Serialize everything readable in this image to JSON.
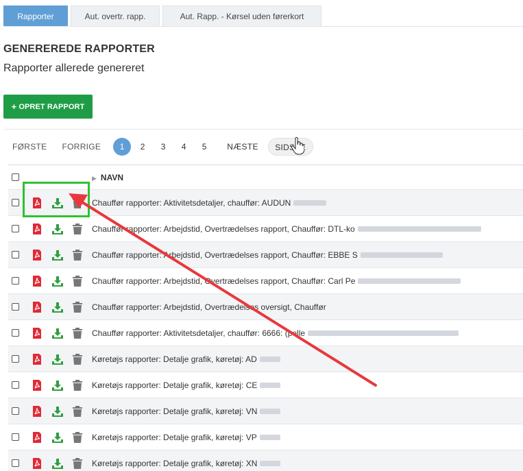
{
  "tabs": [
    {
      "label": "Rapporter",
      "active": true
    },
    {
      "label": "Aut. overtr. rapp.",
      "active": false
    },
    {
      "label": "Aut. Rapp. - Kørsel uden førerkort",
      "active": false
    }
  ],
  "section": {
    "title": "GENEREREDE RAPPORTER",
    "subtitle": "Rapporter allerede genereret"
  },
  "create_button": {
    "label": "OPRET RAPPORT",
    "icon": "plus-icon"
  },
  "pagination": {
    "first": "FØRSTE",
    "prev": "FORRIGE",
    "pages": [
      "1",
      "2",
      "3",
      "4",
      "5"
    ],
    "current": "1",
    "next": "NÆSTE",
    "last": "SIDSTE"
  },
  "table": {
    "header": {
      "name": "NAVN"
    },
    "rows": [
      {
        "name": "Chauffør rapporter: Aktivitetsdetaljer, chauffør: AUDUN"
      },
      {
        "name": "Chauffør rapporter: Arbejdstid, Overtrædelses rapport, Chauffør: DTL-ko"
      },
      {
        "name": "Chauffør rapporter: Arbejdstid, Overtrædelses rapport, Chauffør: EBBE S"
      },
      {
        "name": "Chauffør rapporter: Arbejdstid, Overtrædelses rapport, Chauffør: Carl Pe"
      },
      {
        "name": "Chauffør rapporter: Arbejdstid, Overtrædelses oversigt, Chauffør"
      },
      {
        "name": "Chauffør rapporter: Aktivitetsdetaljer, chauffør: 6666: (pelle"
      },
      {
        "name": "Køretøjs rapporter: Detalje grafik, køretøj: AD"
      },
      {
        "name": "Køretøjs rapporter: Detalje grafik, køretøj: CE"
      },
      {
        "name": "Køretøjs rapporter: Detalje grafik, køretøj: VN"
      },
      {
        "name": "Køretøjs rapporter: Detalje grafik, køretøj: VP"
      },
      {
        "name": "Køretøjs rapporter: Detalje grafik, køretøj: XN"
      }
    ]
  },
  "colors": {
    "accent": "#5f9fd6",
    "create_button": "#1f9d46",
    "pdf_icon": "#e02a36",
    "download_icon": "#2e9e3e",
    "delete_icon": "#777777",
    "highlight_box": "#2fc12f",
    "annotation_arrow": "#e8383d"
  }
}
